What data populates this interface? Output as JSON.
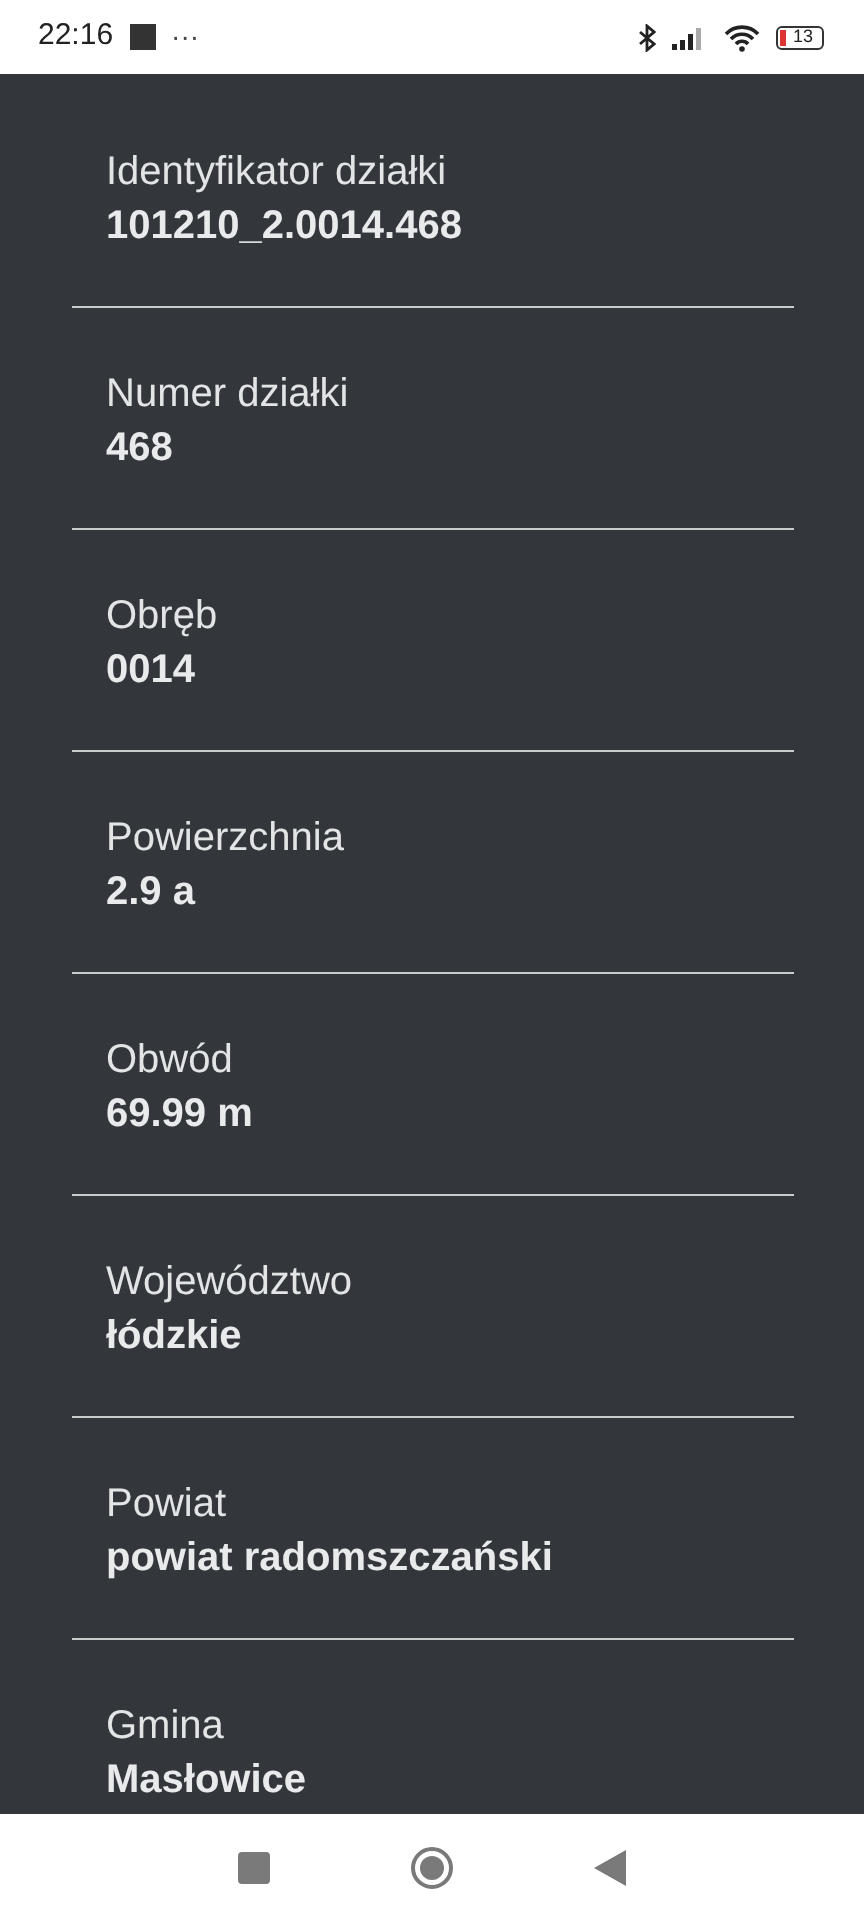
{
  "status_bar": {
    "time": "22:16",
    "more": "···",
    "battery": "13"
  },
  "fields": [
    {
      "label": "Identyfikator działki",
      "value": "101210_2.0014.468"
    },
    {
      "label": "Numer działki",
      "value": "468"
    },
    {
      "label": "Obręb",
      "value": "0014"
    },
    {
      "label": "Powierzchnia",
      "value": "2.9 a"
    },
    {
      "label": "Obwód",
      "value": "69.99 m"
    },
    {
      "label": "Województwo",
      "value": "łódzkie"
    },
    {
      "label": "Powiat",
      "value": "powiat radomszczański"
    },
    {
      "label": "Gmina",
      "value": "Masłowice"
    }
  ]
}
